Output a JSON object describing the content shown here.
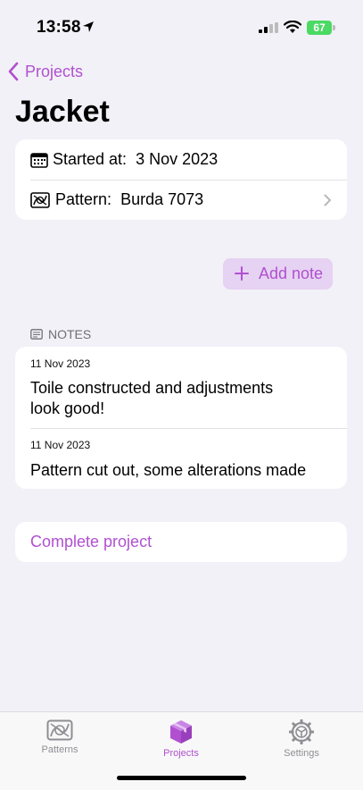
{
  "status": {
    "time": "13:58",
    "battery": "67"
  },
  "nav": {
    "back_label": "Projects"
  },
  "page": {
    "title": "Jacket"
  },
  "info": {
    "started_label": "Started at:",
    "started_value": "3 Nov 2023",
    "pattern_label": "Pattern:",
    "pattern_value": "Burda 7073"
  },
  "actions": {
    "add_note": "Add note",
    "complete": "Complete project"
  },
  "notes": {
    "header": "NOTES",
    "items": [
      {
        "date": "11 Nov 2023",
        "text": "Toile constructed and adjustments look good!"
      },
      {
        "date": "11 Nov 2023",
        "text": "Pattern cut out, some alterations made"
      }
    ]
  },
  "tabs": [
    {
      "label": "Patterns",
      "icon": "pattern-icon",
      "active": false
    },
    {
      "label": "Projects",
      "icon": "box-icon",
      "active": true
    },
    {
      "label": "Settings",
      "icon": "gear-icon",
      "active": false
    }
  ],
  "colors": {
    "accent": "#b050d0",
    "background": "#f2f1f7",
    "accent_soft": "#e6d2f2"
  }
}
